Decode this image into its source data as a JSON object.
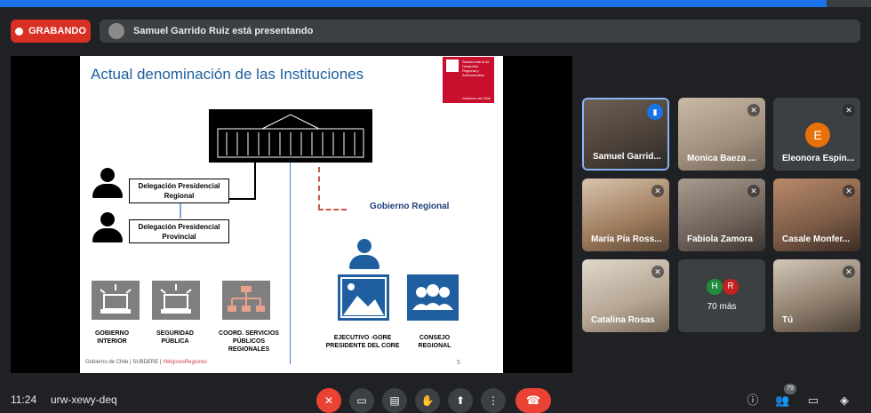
{
  "recording": {
    "label": "GRABANDO"
  },
  "presenting_banner": {
    "text": "Samuel Garrido Ruiz está presentando"
  },
  "slide": {
    "title": "Actual denominación de las Instituciones",
    "logo_text": "Subsecretaría de Desarrollo Regional y Administrativo",
    "logo_sub": "Gobierno de Chile",
    "box_delegacion_regional": "Delegación Presidencial Regional",
    "box_delegacion_provincial": "Delegación Presidencial Provincial",
    "gobierno_regional": "Gobierno Regional",
    "label_gobierno_interior": "GOBIERNO INTERIOR",
    "label_seguridad_publica": "SEGURIDAD PÚBLICA",
    "label_coord_servicios": "COORD. SERVICIOS PÚBLICOS REGIONALES",
    "label_ejecutivo_gore": "EJECUTIVO -GORE PRESIDENTE DEL CORE",
    "label_consejo_regional": "CONSEJO REGIONAL",
    "footer_text": "Gobierno de Chile | SUBDERE |",
    "footer_hashtag": "#MejoresRegiones",
    "page_number": "5"
  },
  "participants": [
    {
      "name": "Samuel Garrid...",
      "speaking": true
    },
    {
      "name": "Monica Baeza ...",
      "muted": true
    },
    {
      "name": "Eleonora Espin...",
      "initial": "E",
      "muted": true
    },
    {
      "name": "María Pía Ross...",
      "muted": true
    },
    {
      "name": "Fabiola Zamora",
      "muted": true
    },
    {
      "name": "Casale Monfer...",
      "muted": true
    },
    {
      "name": "Catalina Rosas",
      "muted": true
    },
    {
      "name": "70 más",
      "initials": [
        "H",
        "R"
      ]
    },
    {
      "name": "Tú",
      "muted": true
    }
  ],
  "bottom_bar": {
    "time": "11:24",
    "meeting_code": "urw-xewy-deq",
    "people_count": "79"
  },
  "colors": {
    "record_red": "#d93025",
    "end_call_red": "#ea4335",
    "accent_blue": "#1a73e8",
    "slide_blue": "#1f5f9f"
  }
}
